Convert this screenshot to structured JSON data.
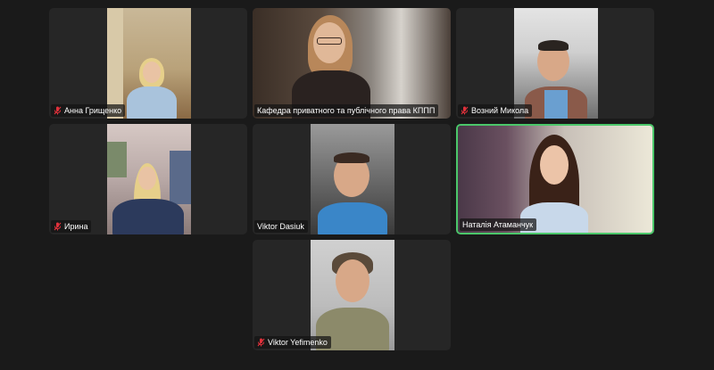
{
  "meeting": {
    "view": "gallery",
    "participants": [
      {
        "name": "Анна Грищенко",
        "muted": true
      },
      {
        "name": "Кафедра приватного та публічного права КППП",
        "muted": false
      },
      {
        "name": "Возний Микола",
        "muted": true
      },
      {
        "name": "Ирина",
        "muted": true
      },
      {
        "name": "Viktor Dasiuk",
        "muted": false
      },
      {
        "name": "Наталія Атаманчук",
        "muted": false,
        "active_speaker": true
      },
      {
        "name": "Viktor Yefimenko",
        "muted": true
      }
    ]
  },
  "colors": {
    "background": "#1a1a1a",
    "tile": "#262626",
    "active_border": "#4bc76a",
    "muted_icon": "#e0313b"
  },
  "icons": {
    "muted": "mic-muted-icon"
  }
}
